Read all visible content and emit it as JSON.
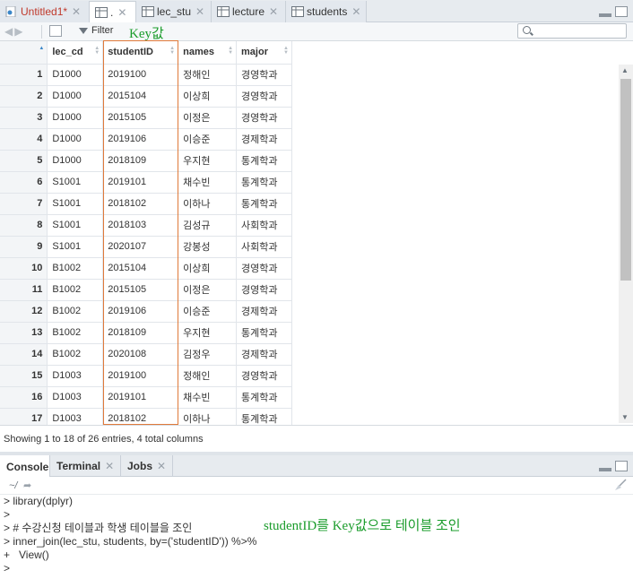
{
  "tabs": [
    {
      "label": "Untitled1*",
      "icon": "r-script-icon",
      "unsaved": true
    },
    {
      "label": ".",
      "icon": "table-icon",
      "active": true
    },
    {
      "label": "lec_stu",
      "icon": "table-icon"
    },
    {
      "label": "lecture",
      "icon": "table-icon"
    },
    {
      "label": "students",
      "icon": "table-icon"
    }
  ],
  "toolbar": {
    "filter_label": "Filter",
    "search_placeholder": ""
  },
  "annotations": {
    "key": "Key값",
    "console": "studentID를 Key값으로 테이블 조인"
  },
  "grid": {
    "columns": [
      "",
      "lec_cd",
      "studentID",
      "names",
      "major"
    ],
    "rows": [
      [
        "1",
        "D1000",
        "2019100",
        "정해인",
        "경영학과"
      ],
      [
        "2",
        "D1000",
        "2015104",
        "이상희",
        "경영학과"
      ],
      [
        "3",
        "D1000",
        "2015105",
        "이정은",
        "경영학과"
      ],
      [
        "4",
        "D1000",
        "2019106",
        "이승준",
        "경제학과"
      ],
      [
        "5",
        "D1000",
        "2018109",
        "우지현",
        "통계학과"
      ],
      [
        "6",
        "S1001",
        "2019101",
        "채수빈",
        "통계학과"
      ],
      [
        "7",
        "S1001",
        "2018102",
        "이하나",
        "통계학과"
      ],
      [
        "8",
        "S1001",
        "2018103",
        "김성규",
        "사회학과"
      ],
      [
        "9",
        "S1001",
        "2020107",
        "강봉성",
        "사회학과"
      ],
      [
        "10",
        "B1002",
        "2015104",
        "이상희",
        "경영학과"
      ],
      [
        "11",
        "B1002",
        "2015105",
        "이정은",
        "경영학과"
      ],
      [
        "12",
        "B1002",
        "2019106",
        "이승준",
        "경제학과"
      ],
      [
        "13",
        "B1002",
        "2018109",
        "우지현",
        "통계학과"
      ],
      [
        "14",
        "B1002",
        "2020108",
        "김정우",
        "경제학과"
      ],
      [
        "15",
        "D1003",
        "2019100",
        "정해인",
        "경영학과"
      ],
      [
        "16",
        "D1003",
        "2019101",
        "채수빈",
        "통계학과"
      ],
      [
        "17",
        "D1003",
        "2018102",
        "이하나",
        "통계학과"
      ]
    ]
  },
  "status": "Showing 1 to 18 of 26 entries, 4 total columns",
  "console_tabs": [
    {
      "label": "Console",
      "active": true
    },
    {
      "label": "Terminal"
    },
    {
      "label": "Jobs"
    }
  ],
  "console_path": "~/",
  "console_lines": [
    "> library(dplyr)",
    ">",
    "> # 수강신청 테이블과 학생 테이블을 조인",
    "> inner_join(lec_stu, students, by=('studentID')) %>%",
    "+   View()",
    ">"
  ],
  "colors": {
    "highlight_box": "#e07a3a",
    "annotation": "#1a9c2b",
    "console_text": "#1a36b8"
  }
}
